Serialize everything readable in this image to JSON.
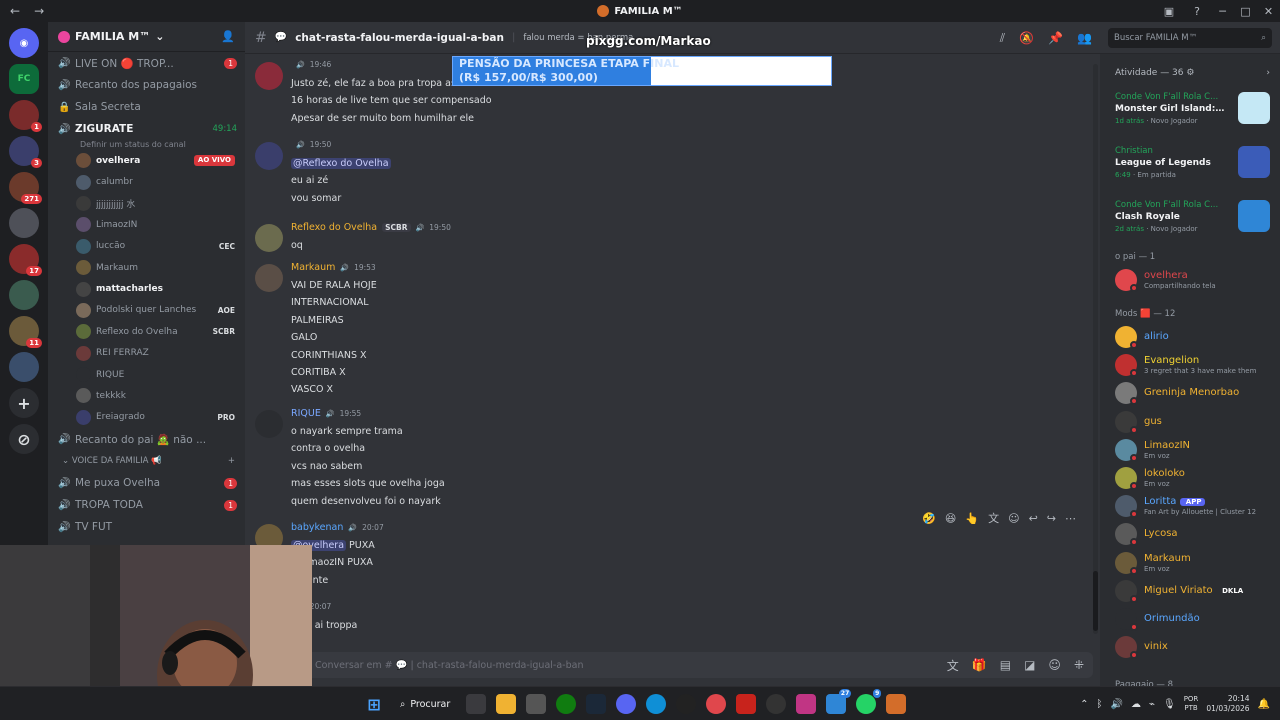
{
  "window": {
    "title": "FAMILIA M™"
  },
  "rail": {
    "servers": [
      {
        "label": "",
        "kind": "home",
        "badge": ""
      },
      {
        "label": "FC",
        "kind": "fc",
        "badge": ""
      },
      {
        "label": "",
        "kind": "s",
        "badge": "1"
      },
      {
        "label": "",
        "kind": "s",
        "badge": "3"
      },
      {
        "label": "",
        "kind": "s",
        "badge": "271"
      },
      {
        "label": "",
        "kind": "s",
        "badge": ""
      },
      {
        "label": "",
        "kind": "s",
        "badge": "17"
      },
      {
        "label": "",
        "kind": "s",
        "badge": ""
      },
      {
        "label": "",
        "kind": "s",
        "badge": "11"
      },
      {
        "label": "",
        "kind": "s",
        "badge": ""
      }
    ]
  },
  "sidebar": {
    "server_name": "FAMILIA M™",
    "channels_top": [
      {
        "icon": "🔊",
        "name": "LIVE ON 🔴 TROP...",
        "badge": "1"
      },
      {
        "icon": "🔊",
        "name": "Recanto dos papagaios",
        "badge": ""
      },
      {
        "icon": "🔒",
        "name": "Sala Secreta",
        "badge": ""
      }
    ],
    "active_channel": {
      "name": "ZIGURATE",
      "timer": "49:14",
      "status": "Definir um status do canal"
    },
    "voice_users": [
      {
        "name": "ovelhera",
        "tag": "",
        "live": "AO VIVO",
        "bold": true
      },
      {
        "name": "calumbr",
        "tag": "",
        "live": "",
        "bold": false
      },
      {
        "name": "jjjjjjjjjjj 水",
        "tag": "",
        "live": "",
        "bold": false
      },
      {
        "name": "LimaozIN",
        "tag": "",
        "live": "",
        "bold": false
      },
      {
        "name": "luccão",
        "tag": "CEC",
        "live": "",
        "bold": false
      },
      {
        "name": "Markaum",
        "tag": "",
        "live": "",
        "bold": false
      },
      {
        "name": "mattacharles",
        "tag": "",
        "live": "",
        "bold": true
      },
      {
        "name": "Podolski quer Lanches",
        "tag": "AOE",
        "live": "",
        "bold": false
      },
      {
        "name": "Reflexo do Ovelha",
        "tag": "SCBR",
        "live": "",
        "bold": false
      },
      {
        "name": "REI FERRAZ",
        "tag": "",
        "live": "",
        "bold": false
      },
      {
        "name": "RIQUE",
        "tag": "",
        "live": "",
        "bold": false
      },
      {
        "name": "tekkkk",
        "tag": "",
        "live": "",
        "bold": false
      },
      {
        "name": "Ereiagrado",
        "tag": "PRO",
        "live": "",
        "bold": false
      }
    ],
    "channels_bottom": [
      {
        "icon": "🔊",
        "name": "Recanto do pai 🧟 não ...",
        "badge": ""
      }
    ],
    "category": "VOICE DA FAMILIA 📢",
    "channels_cat": [
      {
        "icon": "🔊",
        "name": "Me puxa Ovelha",
        "badge": "1"
      },
      {
        "icon": "🔊",
        "name": "TROPA TODA",
        "badge": "1"
      },
      {
        "icon": "🔊",
        "name": "TV FUT",
        "badge": ""
      }
    ]
  },
  "header": {
    "channel_name": "chat-rasta-falou-merda-igual-a-ban",
    "topic": "falou merda = ban perma"
  },
  "overlay": {
    "pix_url": "pixgg.com/Markao",
    "banner_line1": "PENSÃO DA PRINCESA ETAPA FINAL",
    "banner_line2": "(R$ 157,00/R$ 300,00)"
  },
  "messages": [
    {
      "author": "",
      "time": "19:46",
      "color": "#e0474c",
      "tag": "",
      "lines": [
        "Justo zé, ele faz a boa pra tropa as vezes",
        "16 horas de live tem que ser compensado",
        "Apesar de ser muito bom humilhar ele"
      ]
    },
    {
      "author": "",
      "time": "19:50",
      "color": "#e0474c",
      "tag": "",
      "mention": "@Reflexo do Ovelha",
      "lines": [
        "eu ai zé",
        "vou somar"
      ]
    },
    {
      "author": "Reflexo do Ovelha",
      "time": "19:50",
      "color": "#f0b232",
      "tag": "SCBR",
      "lines": [
        "oq"
      ]
    },
    {
      "author": "Markaum",
      "time": "19:53",
      "color": "#f0b232",
      "tag": "",
      "lines": [
        "VAI DE RALA HOJE",
        "INTERNACIONAL",
        "PALMEIRAS",
        "GALO",
        "CORINTHIANS X",
        "CORITIBA X",
        "VASCO X"
      ]
    },
    {
      "author": "RIQUE",
      "time": "19:55",
      "color": "#7aa7ff",
      "tag": "",
      "lines": [
        "o nayark sempre trama",
        "contra o ovelha",
        "vcs nao sabem",
        "mas esses slots que  ovelha joga",
        "quem desenvolveu foi o nayark"
      ]
    },
    {
      "author": "babykenan",
      "time": "20:07",
      "color": "#5aa7ff",
      "tag": "",
      "mention": "@ovelhera",
      "mention_rest": " PUXA",
      "lines": [
        "@LimaozIN PUXA",
        "urgente"
      ]
    },
    {
      "author": "",
      "time": "20:07",
      "color": "#e0474c",
      "tag": "",
      "lines": [
        "vem ai troppa"
      ]
    }
  ],
  "composer": {
    "placeholder": "Conversar em # 💬 | chat-rasta-falou-merda-igual-a-ban"
  },
  "search": {
    "placeholder": "Buscar FAMILIA M™"
  },
  "members": {
    "activity_header": "Atividade — 36",
    "activities": [
      {
        "who": "Conde Von F'all Rola C...",
        "game": "Monster Girl Island: Prolog...",
        "when": "1d atrás",
        "note": "Novo Jogador",
        "color": "#c5e8f5"
      },
      {
        "who": "Christian",
        "game": "League of Legends",
        "when": "6:49",
        "note": "Em partida",
        "color": "#3b5cb8"
      },
      {
        "who": "Conde Von F'all Rola C...",
        "game": "Clash Royale",
        "when": "2d atrás",
        "note": "Novo Jogador",
        "color": "#2f86d6"
      }
    ],
    "group1": "o pai — 1",
    "group1_members": [
      {
        "name": "ovelhera",
        "status": "Compartilhando tela",
        "color": "#e0474c"
      }
    ],
    "group2": "Mods 🟥 — 12",
    "group2_members": [
      {
        "name": "alirio",
        "status": "",
        "color": "#5aa7ff"
      },
      {
        "name": "Evangelion",
        "status": "3 regret that 3 have make them",
        "color": "#f0d232"
      },
      {
        "name": "Greninja Menorbao",
        "status": "",
        "color": "#f0b232"
      },
      {
        "name": "gus",
        "status": "",
        "color": "#f0b232"
      },
      {
        "name": "LimaozIN",
        "status": "Em voz",
        "color": "#f0b232"
      },
      {
        "name": "lokoloko",
        "status": "Em voz",
        "color": "#f0b232"
      },
      {
        "name": "Loritta",
        "status": "Fan Art by Allouette | Cluster 12",
        "tag": "APP",
        "color": "#5aa7ff"
      },
      {
        "name": "Lycosa",
        "status": "",
        "color": "#f0b232"
      },
      {
        "name": "Markaum",
        "status": "Em voz",
        "color": "#f0b232"
      },
      {
        "name": "Miguel Viriato",
        "status": "",
        "tag": "DKLA",
        "color": "#f0b232"
      },
      {
        "name": "Orimundão",
        "status": "",
        "color": "#5aa7ff"
      },
      {
        "name": "vinix",
        "status": "",
        "color": "#f0b232"
      }
    ],
    "group3": "Pagagaio — 8"
  },
  "taskbar": {
    "search_label": "Procurar",
    "lang": "POR",
    "lang2": "PTB",
    "time": "20:14",
    "date": "01/03/2026"
  }
}
